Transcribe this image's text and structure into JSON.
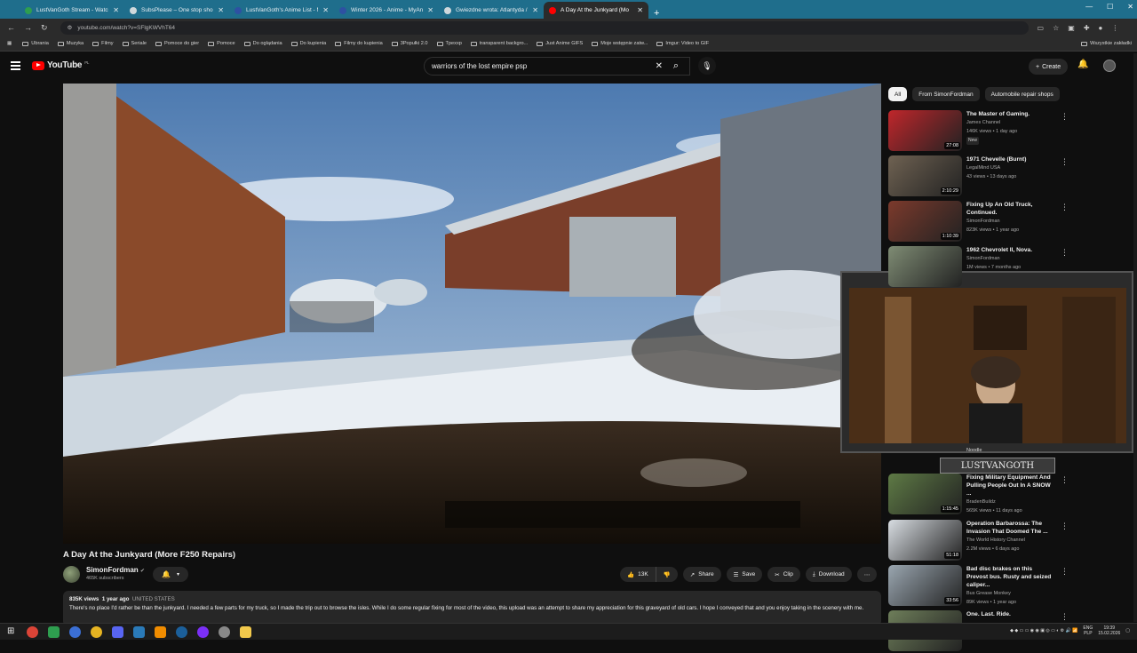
{
  "browser": {
    "tabs": [
      {
        "title": "LustVanGoth Stream - Watch Li",
        "favicon": "#2e9e4f"
      },
      {
        "title": "SubsPlease – One stop shop fo",
        "favicon": "#cfd8dc"
      },
      {
        "title": "LustVanGoth's Anime List - My",
        "favicon": "#2e51a2"
      },
      {
        "title": "Winter 2026 - Anime - MyAnim",
        "favicon": "#2e51a2"
      },
      {
        "title": "Gwiezdne wrota: Atlantyda / Sta",
        "favicon": "#cfd8dc"
      },
      {
        "title": "A Day At the Junkyard (Mo",
        "favicon": "#ff0000"
      }
    ],
    "url": "youtube.com/watch?v=SFlgKWVhT64",
    "bookmarks": [
      "Ubrania",
      "Muzyka",
      "Filmy",
      "Seriale",
      "Pomoce do gier",
      "Pomoce",
      "Do oglądania",
      "Do kupienia",
      "Filmy do kupienia",
      "3Popułki 2.0",
      "Tpexxp",
      "transparent backgro...",
      "Just Anime GIFS",
      "Moje wstępnie zatw...",
      "Imgur: Video to GIF"
    ],
    "bookmarks_right": "Wszystkie zakładki"
  },
  "youtube": {
    "logo": "YouTube",
    "region": "PL",
    "search_query": "warriors of the lost empire psp",
    "create_label": "Create"
  },
  "video": {
    "title": "A Day At the Junkyard (More F250 Repairs)",
    "channel": "SimonFordman",
    "subscribers": "465K subscribers",
    "likes": "13K",
    "share": "Share",
    "save": "Save",
    "clip": "Clip",
    "download": "Download",
    "views": "835K views",
    "age": "1 year ago",
    "location": "UNITED STATES",
    "description": "There's no place I'd rather be than the junkyard. I needed a few parts for my truck, so I made the trip out to browse the isles. While I do some regular fixing for most of the video, this upload was an attempt to share my appreciation for this graveyard of old cars. I hope I conveyed that and you enjoy taking in the scenery with me."
  },
  "chips": [
    "All",
    "From SimonFordman",
    "Automobile repair shops"
  ],
  "recommendations": [
    {
      "title": "The Master of Gaming.",
      "channel": "James Channel",
      "meta": "146K views • 1 day ago",
      "badge": "New",
      "duration": "27:08",
      "color": "#c0262b"
    },
    {
      "title": "1971 Chevelle (Burnt)",
      "channel": "LegalMind USA",
      "meta": "43 views • 13 days ago",
      "badge": "",
      "duration": "2:10:29",
      "color": "#6f6252"
    },
    {
      "title": "Fixing Up An Old Truck, Continued.",
      "channel": "SimonFordman",
      "meta": "823K views • 1 year ago",
      "badge": "",
      "duration": "1:10:39",
      "color": "#7c3a2c"
    },
    {
      "title": "1962 Chevrolet II, Nova.",
      "channel": "SimonFordman",
      "meta": "1M views • 7 months ago",
      "badge": "",
      "duration": "",
      "color": "#7f8c74"
    },
    {
      "title": "Fixing Military Equipment And Pulling People Out In A SNOW ...",
      "channel": "BradenBuildz",
      "meta": "565K views • 11 days ago",
      "badge": "",
      "duration": "1:15:45",
      "color": "#5e7a45"
    },
    {
      "title": "Operation Barbarossa: The Invasion That Doomed The ...",
      "channel": "The World History Channel",
      "meta": "2.2M views • 6 days ago",
      "badge": "",
      "duration": "51:18",
      "color": "#d8dde2"
    },
    {
      "title": "Bad disc brakes on this Prevost bus. Rusty and seized caliper...",
      "channel": "Bus Grease Monkey",
      "meta": "89K views • 1 year ago",
      "badge": "",
      "duration": "33:56",
      "color": "#9aa6b0"
    },
    {
      "title": "One. Last. Ride.",
      "channel": "",
      "meta": "",
      "badge": "",
      "duration": "",
      "color": "#6e7e5a"
    }
  ],
  "stream_overlay": {
    "username": "LUSTVANGOTH",
    "above": "Noodle"
  },
  "taskbar": {
    "lang": "ENG\nPLP",
    "time": "19:39",
    "date": "15.02.2026"
  }
}
